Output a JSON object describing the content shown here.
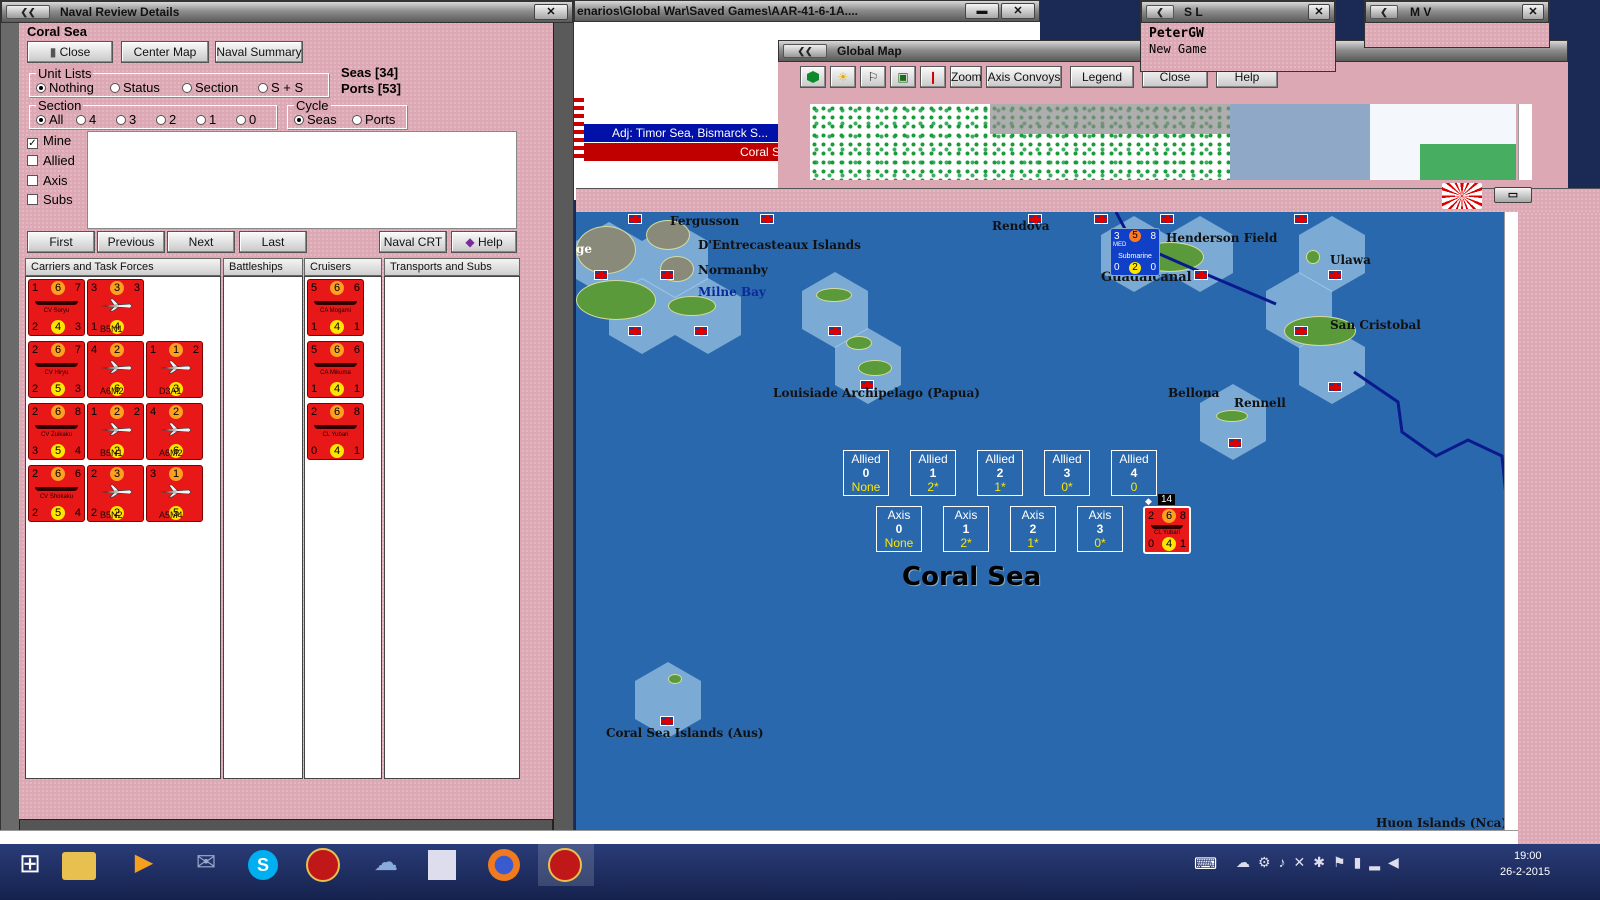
{
  "naval_review": {
    "title": "Naval Review Details",
    "sea_name": "Coral Sea",
    "buttons": {
      "close": "Close",
      "center_map": "Center Map",
      "naval_summary": "Naval Summary"
    },
    "unit_lists": {
      "title": "Unit Lists",
      "options": [
        "Nothing",
        "Status",
        "Section",
        "S + S"
      ],
      "selected": "Nothing"
    },
    "seas": "Seas [34]",
    "ports": "Ports [53]",
    "section": {
      "title": "Section",
      "options": [
        "All",
        "4",
        "3",
        "2",
        "1",
        "0"
      ],
      "selected": "All"
    },
    "cycle": {
      "title": "Cycle",
      "options": [
        "Seas",
        "Ports"
      ],
      "selected": "Seas"
    },
    "filters": [
      {
        "label": "Mine",
        "checked": true
      },
      {
        "label": "Allied",
        "checked": false
      },
      {
        "label": "Axis",
        "checked": false
      },
      {
        "label": "Subs",
        "checked": false
      }
    ],
    "nav_buttons": {
      "first": "First",
      "previous": "Previous",
      "next": "Next",
      "last": "Last",
      "naval_crt": "Naval CRT",
      "help": "Help"
    },
    "columns": [
      "Carriers and Task Forces",
      "Battleships",
      "Cruisers",
      "Transports and Subs"
    ],
    "carrier_units": [
      {
        "tl": "1",
        "tm": "6",
        "tr": "7",
        "bl": "2",
        "bm": "4",
        "br": "3",
        "name": "CV Soryu",
        "kind": "ship"
      },
      {
        "tl": "3",
        "tm": "3",
        "tr": "3",
        "bl": "1",
        "bm": "4",
        "br": "",
        "name": "B5N1",
        "kind": "plane"
      },
      {
        "tl": "2",
        "tm": "6",
        "tr": "7",
        "bl": "2",
        "bm": "5",
        "br": "3",
        "name": "CV Hiryu",
        "kind": "ship"
      },
      {
        "tl": "4",
        "tm": "2",
        "tr": "",
        "bl": "",
        "bm": "6",
        "br": "",
        "name": "A6M2",
        "kind": "plane"
      },
      {
        "tl": "1",
        "tm": "1",
        "tr": "2",
        "bl": "",
        "bm": "3",
        "br": "",
        "name": "D3A1",
        "kind": "plane"
      },
      {
        "tl": "2",
        "tm": "6",
        "tr": "8",
        "bl": "3",
        "bm": "5",
        "br": "4",
        "name": "CV Zuikaku",
        "kind": "ship"
      },
      {
        "tl": "1",
        "tm": "2",
        "tr": "2",
        "bl": "",
        "bm": "2",
        "br": "",
        "name": "B5N1",
        "kind": "plane"
      },
      {
        "tl": "4",
        "tm": "2",
        "tr": "",
        "bl": "",
        "bm": "6",
        "br": "",
        "name": "A6M2",
        "kind": "plane"
      },
      {
        "tl": "2",
        "tm": "6",
        "tr": "6",
        "bl": "2",
        "bm": "5",
        "br": "4",
        "name": "CV Shokaku",
        "kind": "ship"
      },
      {
        "tl": "2",
        "tm": "3",
        "tr": "",
        "bl": "2",
        "bm": "2",
        "br": "",
        "name": "B5N2",
        "kind": "plane"
      },
      {
        "tl": "3",
        "tm": "1",
        "tr": "",
        "bl": "",
        "bm": "5",
        "br": "",
        "name": "A5M4",
        "kind": "plane"
      }
    ],
    "cruiser_units": [
      {
        "tl": "5",
        "tm": "6",
        "tr": "6",
        "bl": "1",
        "bm": "4",
        "br": "1",
        "name": "CA Mogami",
        "kind": "ship"
      },
      {
        "tl": "5",
        "tm": "6",
        "tr": "6",
        "bl": "1",
        "bm": "4",
        "br": "1",
        "name": "CA Mikuma",
        "kind": "ship"
      },
      {
        "tl": "2",
        "tm": "6",
        "tr": "8",
        "bl": "0",
        "bm": "4",
        "br": "1",
        "name": "CL Yubari",
        "kind": "ship"
      }
    ]
  },
  "background_window": {
    "title": "enarios\\Global War\\Saved Games\\AAR-41-6-1A....",
    "adj_text": "Adj: Timor Sea, Bismarck S...",
    "coral_text": "Coral S"
  },
  "global_map": {
    "title": "Global Map",
    "buttons": [
      "Zoom",
      "Axis Convoys",
      "Legend",
      "Close",
      "Help"
    ]
  },
  "sl_window": {
    "title": "S L",
    "player": "PeterGW",
    "game": "New Game"
  },
  "mv_window": {
    "title": "M V"
  },
  "map": {
    "sea_title": "Coral Sea",
    "labels": [
      "Fergusson",
      "D'Entrecasteaux Islands",
      "Normanby",
      "Milne Bay",
      "Rendova",
      "Henderson Field",
      "Guadalcanal",
      "Ulawa",
      "San Cristobal",
      "Louisiade Archipelago (Papua)",
      "Bellona",
      "Rennell",
      "Coral Sea Islands (Aus)",
      "Huon Islands (Nca)",
      "ge"
    ],
    "allied_boxes": [
      {
        "label": "Allied",
        "num": "0",
        "val": "None"
      },
      {
        "label": "Allied",
        "num": "1",
        "val": "2*"
      },
      {
        "label": "Allied",
        "num": "2",
        "val": "1*"
      },
      {
        "label": "Allied",
        "num": "3",
        "val": "0*"
      },
      {
        "label": "Allied",
        "num": "4",
        "val": "0"
      }
    ],
    "axis_boxes": [
      {
        "label": "Axis",
        "num": "0",
        "val": "None"
      },
      {
        "label": "Axis",
        "num": "1",
        "val": "2*"
      },
      {
        "label": "Axis",
        "num": "2",
        "val": "1*"
      },
      {
        "label": "Axis",
        "num": "3",
        "val": "0*"
      }
    ],
    "stack_count": "14",
    "map_unit": {
      "tl": "2",
      "tm": "6",
      "tr": "8",
      "bl": "0",
      "bm": "4",
      "br": "1",
      "name": "CL Yubari"
    },
    "sub_unit": {
      "tl": "3",
      "tm": "5",
      "tr": "8",
      "bl": "0",
      "bm": "2",
      "br": "0",
      "name": "Submarine",
      "tag": "MED"
    }
  },
  "taskbar": {
    "time": "19:00",
    "date": "26-2-2015",
    "apps": [
      "start-icon",
      "file-explorer-icon",
      "media-player-icon",
      "mail-icon",
      "skype-icon",
      "wif-game-icon",
      "browser-icon",
      "editor-icon",
      "firefox-icon",
      "wif-game-active-icon"
    ]
  }
}
